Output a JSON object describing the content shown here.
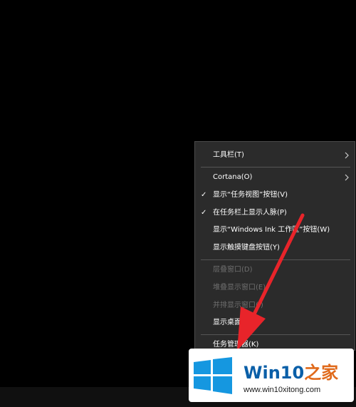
{
  "context_menu": {
    "items": [
      {
        "label": "工具栏(T)",
        "checked": false,
        "disabled": false,
        "submenu": true
      },
      {
        "label": "Cortana(O)",
        "checked": false,
        "disabled": false,
        "submenu": true
      },
      {
        "label": "显示“任务视图”按钮(V)",
        "checked": true,
        "disabled": false,
        "submenu": false
      },
      {
        "label": "在任务栏上显示人脉(P)",
        "checked": true,
        "disabled": false,
        "submenu": false
      },
      {
        "label": "显示“Windows Ink 工作区”按钮(W)",
        "checked": false,
        "disabled": false,
        "submenu": false
      },
      {
        "label": "显示触摸键盘按钮(Y)",
        "checked": false,
        "disabled": false,
        "submenu": false
      },
      {
        "label": "层叠窗口(D)",
        "checked": false,
        "disabled": true,
        "submenu": false
      },
      {
        "label": "堆叠显示窗口(E)",
        "checked": false,
        "disabled": true,
        "submenu": false
      },
      {
        "label": "并排显示窗口(I)",
        "checked": false,
        "disabled": true,
        "submenu": false
      },
      {
        "label": "显示桌面(S)",
        "checked": false,
        "disabled": false,
        "submenu": false
      },
      {
        "label": "任务管理器(K)",
        "checked": false,
        "disabled": false,
        "submenu": false
      }
    ],
    "check_glyph": "✓"
  },
  "watermark": {
    "brand_latin": "Win10",
    "brand_cn": "之家",
    "site": "www.win10xitong.com"
  },
  "colors": {
    "menu_bg": "#2b2b2b",
    "menu_text": "#ffffff",
    "disabled_text": "#6e6e6e",
    "arrow_red": "#e8242a",
    "logo_blue": "#1597e0"
  }
}
